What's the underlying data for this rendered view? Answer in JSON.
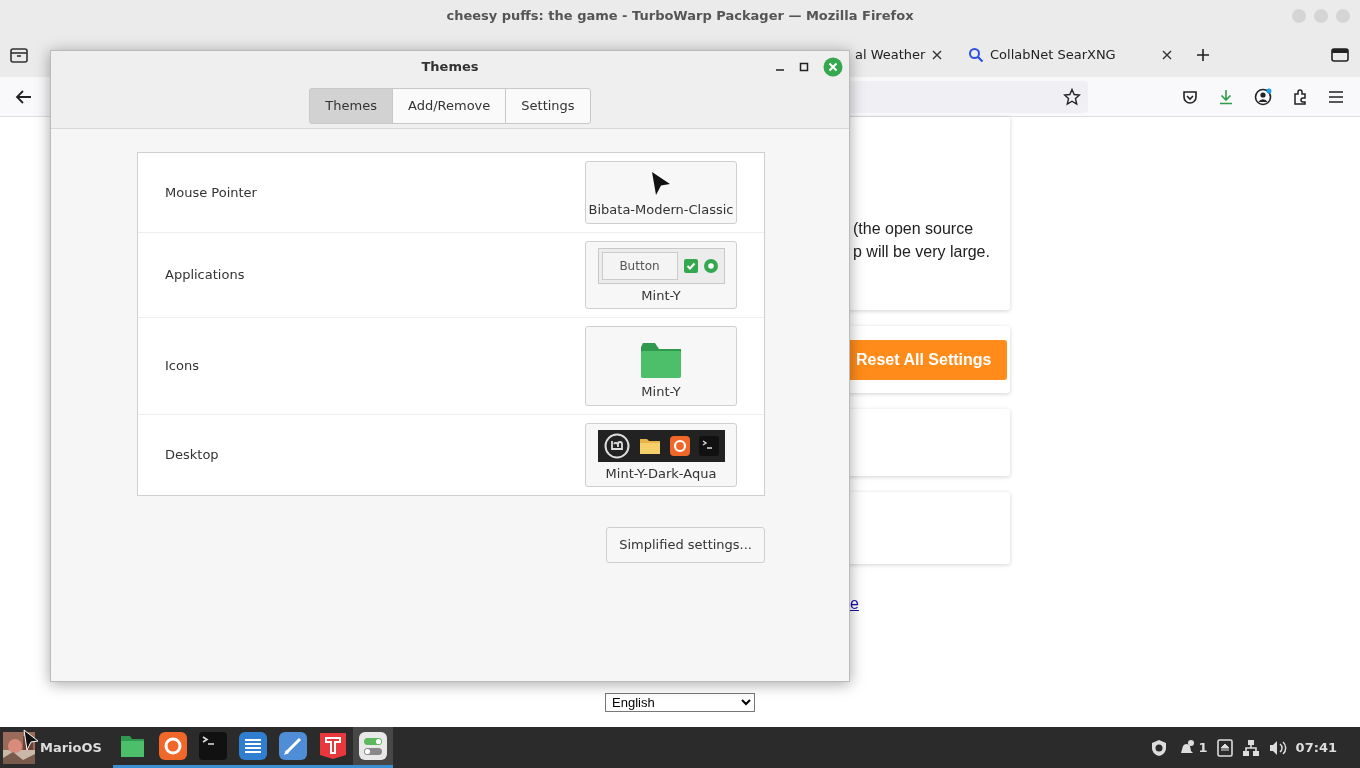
{
  "browser": {
    "title": "cheesy puffs: the game - TurboWarp Packager — Mozilla Firefox",
    "tabs": [
      {
        "label": "al Weather",
        "selected": false,
        "kind": "weather"
      },
      {
        "label": "CollabNet SearXNG",
        "selected": false,
        "kind": "search"
      }
    ],
    "page": {
      "paragraph_lines": [
        "(the open source",
        "p will be very large."
      ],
      "reset_button": "Reset All Settings",
      "link": "e",
      "language": "English"
    }
  },
  "dialog": {
    "title": "Themes",
    "tabs": [
      {
        "label": "Themes",
        "selected": true
      },
      {
        "label": "Add/Remove",
        "selected": false
      },
      {
        "label": "Settings",
        "selected": false
      }
    ],
    "rows": [
      {
        "label": "Mouse Pointer",
        "theme": "Bibata-Modern-Classic",
        "kind": "pointer"
      },
      {
        "label": "Applications",
        "theme": "Mint-Y",
        "kind": "applications",
        "preview_text": "Button"
      },
      {
        "label": "Icons",
        "theme": "Mint-Y",
        "kind": "icons"
      },
      {
        "label": "Desktop",
        "theme": "Mint-Y-Dark-Aqua",
        "kind": "desktop"
      }
    ],
    "simplified_button": "Simplified settings..."
  },
  "taskbar": {
    "menu_label": "MarioOS",
    "apps": [
      {
        "kind": "files",
        "running": true,
        "active": false
      },
      {
        "kind": "firefox",
        "running": true,
        "active": false
      },
      {
        "kind": "terminal",
        "running": true,
        "active": false
      },
      {
        "kind": "editor",
        "running": true,
        "active": false
      },
      {
        "kind": "notes",
        "running": true,
        "active": false
      },
      {
        "kind": "typing",
        "running": true,
        "active": false
      },
      {
        "kind": "settings",
        "running": true,
        "active": true
      }
    ],
    "notification_count": "1",
    "clock": "07:41"
  }
}
